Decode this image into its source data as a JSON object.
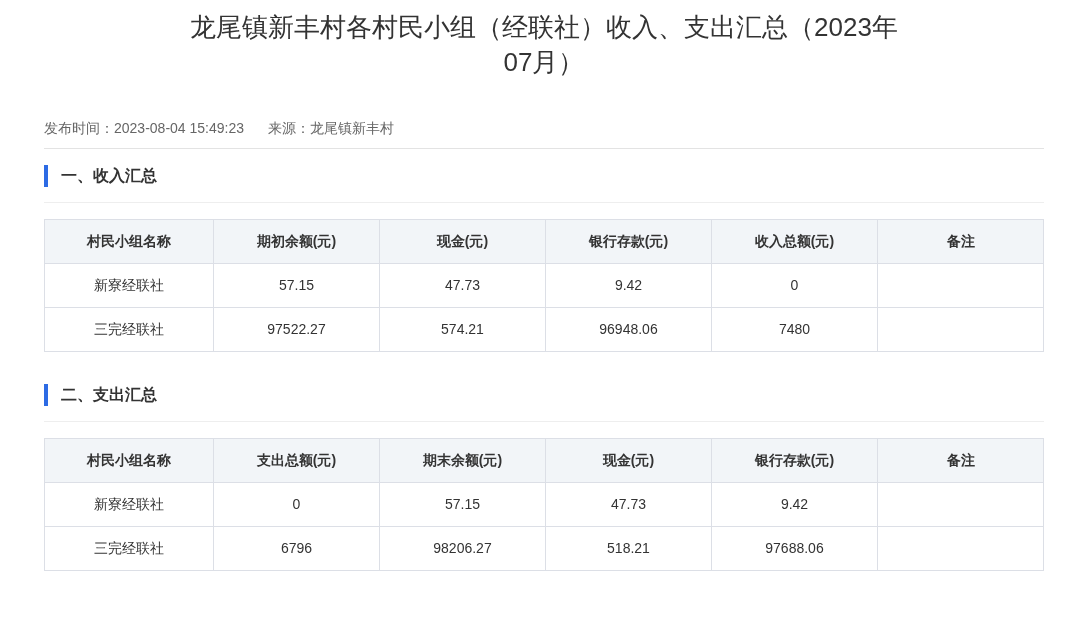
{
  "title": "龙尾镇新丰村各村民小组（经联社）收入、支出汇总（2023年07月）",
  "meta": {
    "publish_label": "发布时间：",
    "publish_time": "2023-08-04 15:49:23",
    "source_label": "来源：",
    "source": "龙尾镇新丰村"
  },
  "sections": [
    {
      "heading": "一、收入汇总",
      "table": {
        "columns": [
          "村民小组名称",
          "期初余额(元)",
          "现金(元)",
          "银行存款(元)",
          "收入总额(元)",
          "备注"
        ],
        "rows": [
          [
            "新寮经联社",
            "57.15",
            "47.73",
            "9.42",
            "0",
            ""
          ],
          [
            "三完经联社",
            "97522.27",
            "574.21",
            "96948.06",
            "7480",
            ""
          ]
        ]
      }
    },
    {
      "heading": "二、支出汇总",
      "table": {
        "columns": [
          "村民小组名称",
          "支出总额(元)",
          "期末余额(元)",
          "现金(元)",
          "银行存款(元)",
          "备注"
        ],
        "rows": [
          [
            "新寮经联社",
            "0",
            "57.15",
            "47.73",
            "9.42",
            ""
          ],
          [
            "三完经联社",
            "6796",
            "98206.27",
            "518.21",
            "97688.06",
            ""
          ]
        ]
      }
    }
  ]
}
